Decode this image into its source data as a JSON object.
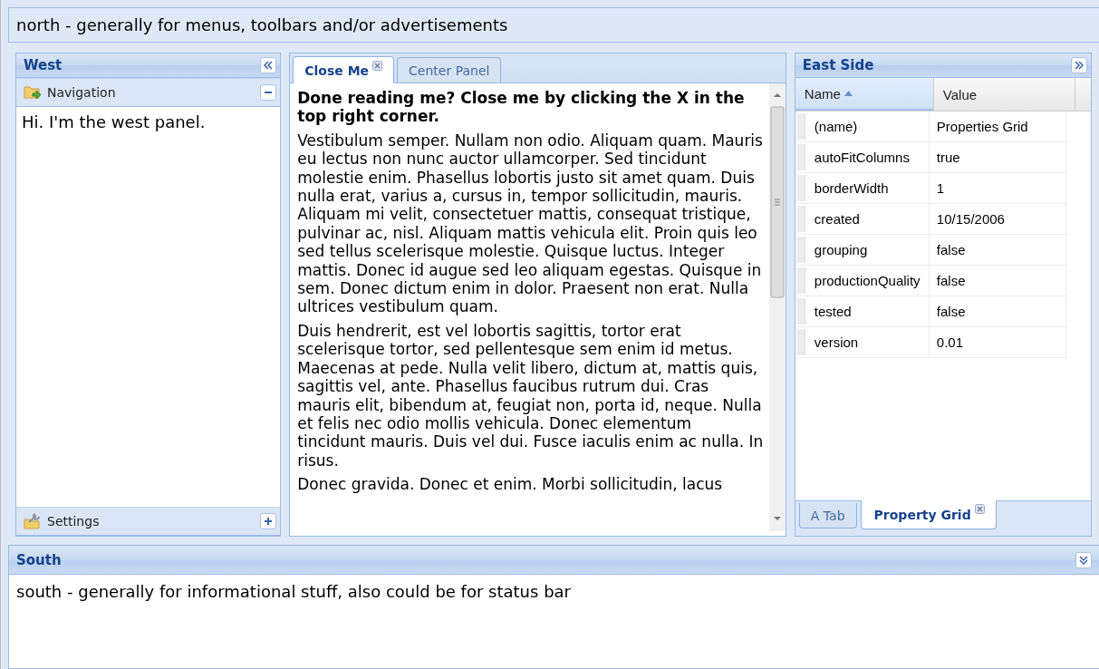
{
  "north": {
    "text": "north - generally for menus, toolbars and/or advertisements"
  },
  "west": {
    "title": "West",
    "accordion": [
      {
        "title": "Navigation",
        "expanded": true,
        "body": "Hi. I'm the west panel."
      },
      {
        "title": "Settings",
        "expanded": false
      }
    ]
  },
  "center": {
    "tabs": [
      {
        "label": "Close Me",
        "selected": true,
        "closable": true
      },
      {
        "label": "Center Panel",
        "selected": false,
        "closable": false
      }
    ],
    "heading": "Done reading me? Close me by clicking the X in the top right corner.",
    "paragraphs": [
      "Vestibulum semper. Nullam non odio. Aliquam quam. Mauris eu lectus non nunc auctor ullamcorper. Sed tincidunt molestie enim. Phasellus lobortis justo sit amet quam. Duis nulla erat, varius a, cursus in, tempor sollicitudin, mauris. Aliquam mi velit, consectetuer mattis, consequat tristique, pulvinar ac, nisl. Aliquam mattis vehicula elit. Proin quis leo sed tellus scelerisque molestie. Quisque luctus. Integer mattis. Donec id augue sed leo aliquam egestas. Quisque in sem. Donec dictum enim in dolor. Praesent non erat. Nulla ultrices vestibulum quam.",
      "Duis hendrerit, est vel lobortis sagittis, tortor erat scelerisque tortor, sed pellentesque sem enim id metus. Maecenas at pede. Nulla velit libero, dictum at, mattis quis, sagittis vel, ante. Phasellus faucibus rutrum dui. Cras mauris elit, bibendum at, feugiat non, porta id, neque. Nulla et felis nec odio mollis vehicula. Donec elementum tincidunt mauris. Duis vel dui. Fusce iaculis enim ac nulla. In risus.",
      "Donec gravida. Donec et enim. Morbi sollicitudin, lacus"
    ]
  },
  "east": {
    "title": "East Side",
    "grid": {
      "columns": [
        {
          "label": "Name",
          "sorted": true
        },
        {
          "label": "Value",
          "sorted": false
        }
      ],
      "rows": [
        {
          "name": "(name)",
          "value": "Properties Grid"
        },
        {
          "name": "autoFitColumns",
          "value": "true"
        },
        {
          "name": "borderWidth",
          "value": "1"
        },
        {
          "name": "created",
          "value": "10/15/2006"
        },
        {
          "name": "grouping",
          "value": "false"
        },
        {
          "name": "productionQuality",
          "value": "false"
        },
        {
          "name": "tested",
          "value": "false"
        },
        {
          "name": "version",
          "value": "0.01"
        }
      ]
    },
    "tabs": [
      {
        "label": "A Tab",
        "selected": false,
        "closable": false
      },
      {
        "label": "Property Grid",
        "selected": true,
        "closable": true
      }
    ]
  },
  "south": {
    "title": "South",
    "text": "south - generally for informational stuff, also could be for status bar"
  }
}
